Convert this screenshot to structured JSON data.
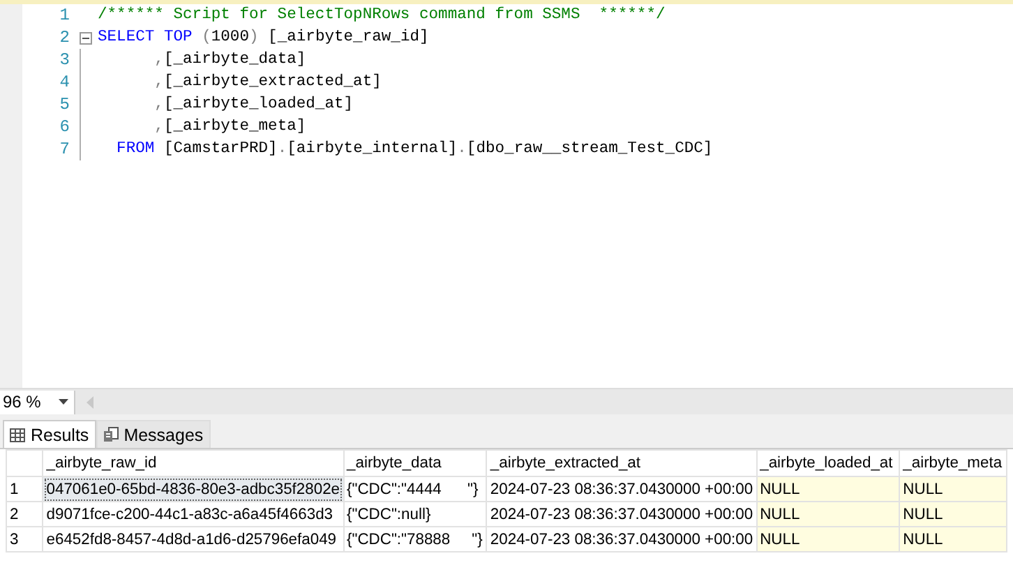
{
  "editor": {
    "lines": [
      {
        "number": "1",
        "foldable": false,
        "tokens": [
          {
            "kind": "comment",
            "text": "/****** Script for SelectTopNRows command from SSMS  ******/"
          }
        ]
      },
      {
        "number": "2",
        "foldable": true,
        "tokens": [
          {
            "kind": "keyword",
            "text": "SELECT TOP "
          },
          {
            "kind": "operator",
            "text": "("
          },
          {
            "kind": "plain",
            "text": "1000"
          },
          {
            "kind": "operator",
            "text": ")"
          },
          {
            "kind": "plain",
            "text": " [_airbyte_raw_id]"
          }
        ]
      },
      {
        "number": "3",
        "foldable": false,
        "tokens": [
          {
            "kind": "operator",
            "text": "      ,"
          },
          {
            "kind": "plain",
            "text": "[_airbyte_data]"
          }
        ]
      },
      {
        "number": "4",
        "foldable": false,
        "tokens": [
          {
            "kind": "operator",
            "text": "      ,"
          },
          {
            "kind": "plain",
            "text": "[_airbyte_extracted_at]"
          }
        ]
      },
      {
        "number": "5",
        "foldable": false,
        "tokens": [
          {
            "kind": "operator",
            "text": "      ,"
          },
          {
            "kind": "plain",
            "text": "[_airbyte_loaded_at]"
          }
        ]
      },
      {
        "number": "6",
        "foldable": false,
        "tokens": [
          {
            "kind": "operator",
            "text": "      ,"
          },
          {
            "kind": "plain",
            "text": "[_airbyte_meta]"
          }
        ]
      },
      {
        "number": "7",
        "foldable": false,
        "tokens": [
          {
            "kind": "keyword",
            "text": "  FROM"
          },
          {
            "kind": "plain",
            "text": " [CamstarPRD]"
          },
          {
            "kind": "operator",
            "text": "."
          },
          {
            "kind": "plain",
            "text": "[airbyte_internal]"
          },
          {
            "kind": "operator",
            "text": "."
          },
          {
            "kind": "plain",
            "text": "[dbo_raw__stream_Test_CDC]"
          }
        ]
      }
    ]
  },
  "zoom": {
    "value": "96 %"
  },
  "tabs": [
    {
      "label": "Results",
      "selected": true
    },
    {
      "label": "Messages",
      "selected": false
    }
  ],
  "table": {
    "columns": [
      "_airbyte_raw_id",
      "_airbyte_data",
      "_airbyte_extracted_at",
      "_airbyte_loaded_at",
      "_airbyte_meta"
    ],
    "rows": [
      {
        "number": "1",
        "cells": [
          {
            "text": "047061e0-65bd-4836-80e3-adbc35f2802e",
            "kind": "value",
            "selected": true
          },
          {
            "text": "{\"CDC\":\"4444      \"}",
            "kind": "value",
            "selected": false
          },
          {
            "text": "2024-07-23 08:36:37.0430000 +00:00",
            "kind": "value",
            "selected": false
          },
          {
            "text": "NULL",
            "kind": "null",
            "selected": false
          },
          {
            "text": "NULL",
            "kind": "null",
            "selected": false
          }
        ]
      },
      {
        "number": "2",
        "cells": [
          {
            "text": "d9071fce-c200-44c1-a83c-a6a45f4663d3",
            "kind": "value",
            "selected": false
          },
          {
            "text": "{\"CDC\":null}",
            "kind": "value",
            "selected": false
          },
          {
            "text": "2024-07-23 08:36:37.0430000 +00:00",
            "kind": "value",
            "selected": false
          },
          {
            "text": "NULL",
            "kind": "null",
            "selected": false
          },
          {
            "text": "NULL",
            "kind": "null",
            "selected": false
          }
        ]
      },
      {
        "number": "3",
        "cells": [
          {
            "text": "e6452fd8-8457-4d8d-a1d6-d25796efa049",
            "kind": "value",
            "selected": false
          },
          {
            "text": "{\"CDC\":\"78888     \"}",
            "kind": "value",
            "selected": false
          },
          {
            "text": "2024-07-23 08:36:37.0430000 +00:00",
            "kind": "value",
            "selected": false
          },
          {
            "text": "NULL",
            "kind": "null",
            "selected": false
          },
          {
            "text": "NULL",
            "kind": "null",
            "selected": false
          }
        ]
      }
    ]
  }
}
